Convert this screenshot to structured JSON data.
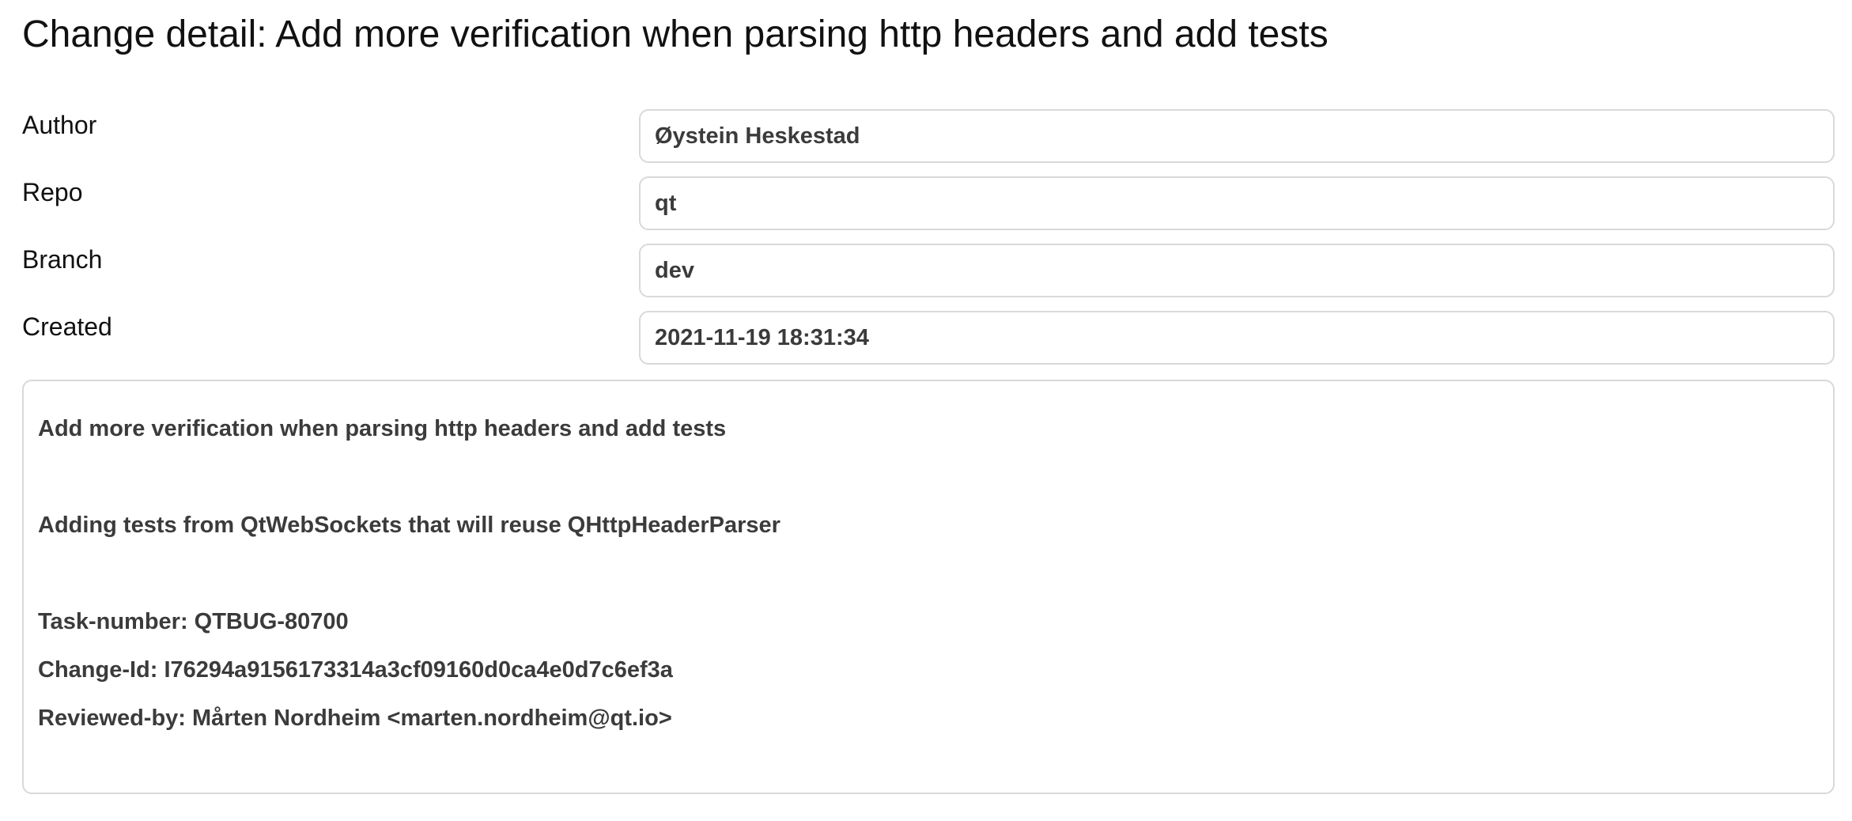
{
  "page": {
    "title": "Change detail: Add more verification when parsing http headers and add tests"
  },
  "fields": [
    {
      "label": "Author",
      "value": "Øystein Heskestad"
    },
    {
      "label": "Repo",
      "value": "qt"
    },
    {
      "label": "Branch",
      "value": "dev"
    },
    {
      "label": "Created",
      "value": "2021-11-19 18:31:34"
    }
  ],
  "message": {
    "subject": "Add more verification when parsing http headers and add tests",
    "body": "Adding tests from QtWebSockets that will reuse QHttpHeaderParser",
    "task_number": "Task-number: QTBUG-80700",
    "change_id": "Change-Id: I76294a9156173314a3cf09160d0ca4e0d7c6ef3a",
    "reviewed_by": "Reviewed-by: Mårten Nordheim <marten.nordheim@qt.io>"
  }
}
